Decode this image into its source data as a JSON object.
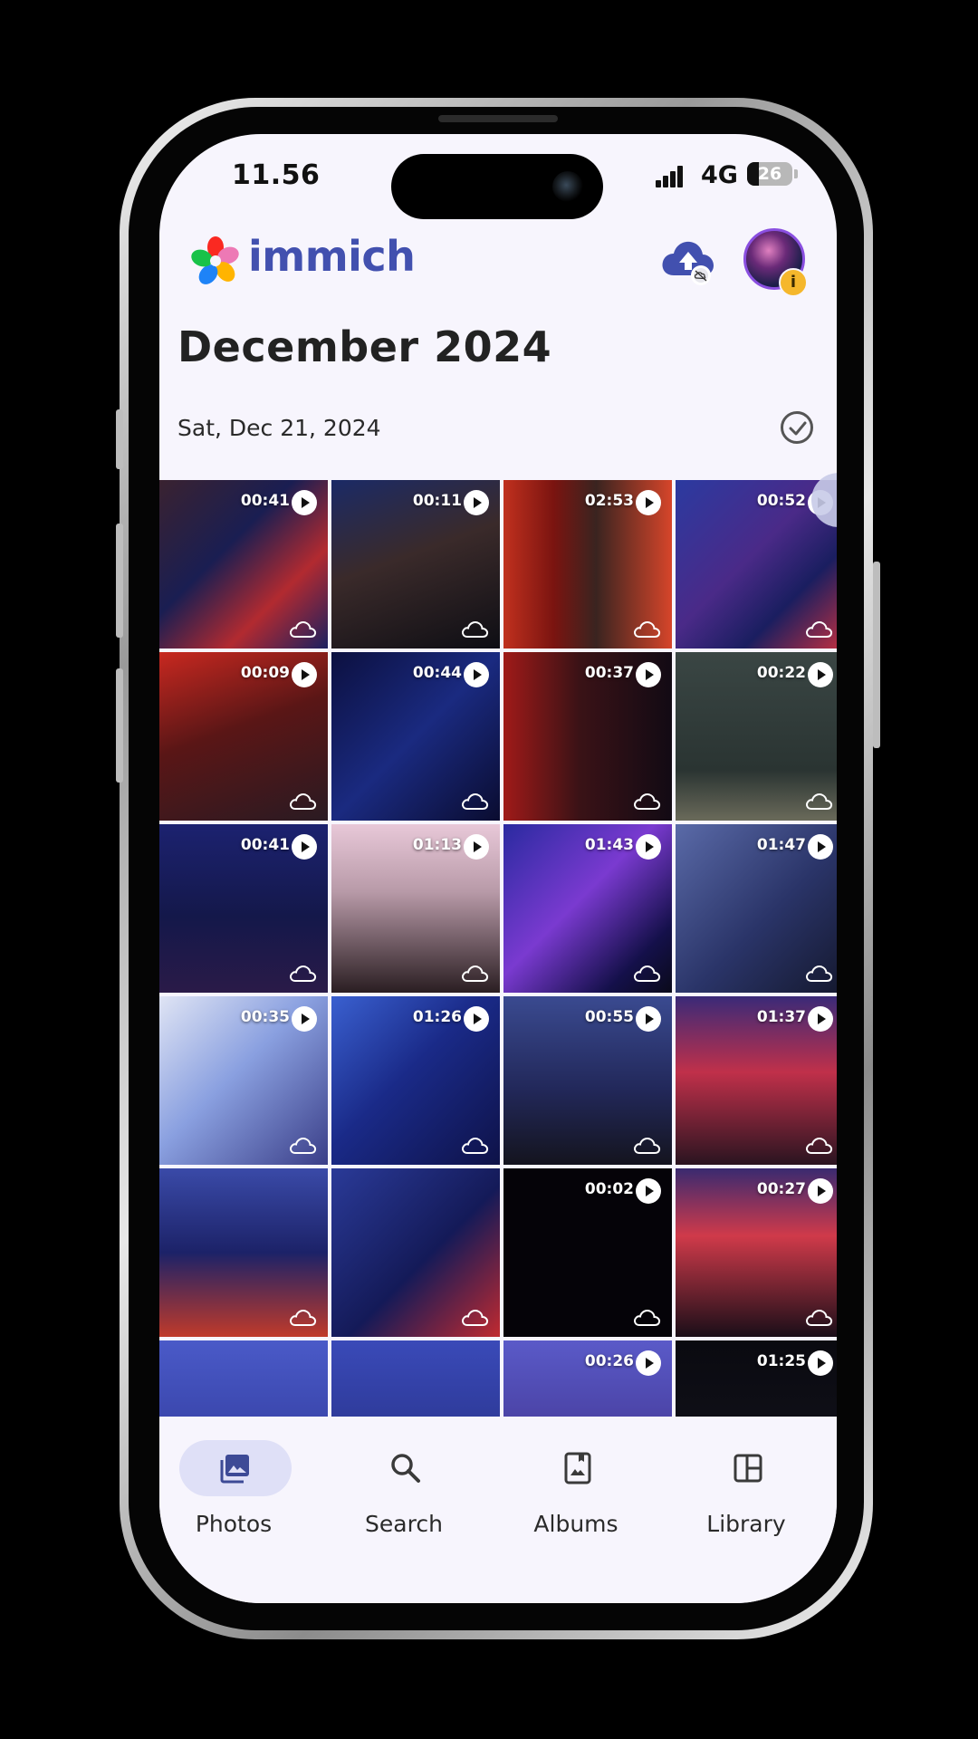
{
  "status_bar": {
    "time": "11.56",
    "network": "4G",
    "battery": "26",
    "battery_level": 0.26
  },
  "header": {
    "app_name": "immich",
    "upload_icon": "cloud-upload-icon",
    "avatar_badge_icon": "info-icon"
  },
  "timeline": {
    "month_title": "December 2024",
    "date_label": "Sat, Dec 21, 2024"
  },
  "tiles": [
    {
      "duration": "00:41",
      "bg": "linear-gradient(135deg,#3a2230 0%,#1a1e52 40%,#b22a30 70%,#1b2060 100%)"
    },
    {
      "duration": "00:11",
      "bg": "linear-gradient(160deg,#1b2a66 0%,#3a2a2a 45%,#0e0e14 100%)"
    },
    {
      "duration": "02:53",
      "bg": "linear-gradient(90deg,#c0301e 0%,#7a1410 30%,#3a2420 55%,#d6452a 100%)"
    },
    {
      "duration": "00:52",
      "bg": "linear-gradient(135deg,#2b3aa0 0%,#4a2a88 45%,#1a1e60 70%,#c03040 100%)"
    },
    {
      "duration": "00:09",
      "bg": "linear-gradient(160deg,#c82820 0%,#5a1616 45%,#2a1a22 100%)"
    },
    {
      "duration": "00:44",
      "bg": "linear-gradient(135deg,#0c1040 0%,#1a2a80 50%,#0a0c30 100%)"
    },
    {
      "duration": "00:37",
      "bg": "linear-gradient(90deg,#a01a18 0%,#3a1216 45%,#120a14 100%)"
    },
    {
      "duration": "00:22",
      "bg": "linear-gradient(180deg,#3a4644 0%,#2a3432 70%,#6a6a5a 100%)"
    },
    {
      "duration": "00:41",
      "bg": "linear-gradient(180deg,#1c2270 0%,#14184a 55%,#2a1a48 100%)"
    },
    {
      "duration": "01:13",
      "bg": "linear-gradient(180deg,#e8c8d8 0%,#b89aa8 40%,#2a1e22 100%)"
    },
    {
      "duration": "01:43",
      "bg": "linear-gradient(135deg,#2a2aa0 0%,#7a3ad0 45%,#14104a 80%,#0a0a1a 100%)"
    },
    {
      "duration": "01:47",
      "bg": "linear-gradient(135deg,#5a6aa8 0%,#2a3468 55%,#14182e 100%)"
    },
    {
      "duration": "00:35",
      "bg": "linear-gradient(135deg,#dfe4f4 0%,#8aa0e0 45%,#3a3e88 100%)"
    },
    {
      "duration": "01:26",
      "bg": "linear-gradient(135deg,#3a60d0 0%,#1a2a88 45%,#0e1248 100%)"
    },
    {
      "duration": "00:55",
      "bg": "linear-gradient(180deg,#3a4a90 0%,#22285a 55%,#14141e 100%)"
    },
    {
      "duration": "01:37",
      "bg": "linear-gradient(180deg,#3a2a78 0%,#c0304a 45%,#2a1420 100%)"
    },
    {
      "duration": "",
      "bg": "linear-gradient(180deg,#3a4aa8 0%,#1c2268 50%,#c03a2a 100%)"
    },
    {
      "duration": "",
      "bg": "linear-gradient(135deg,#2a3a98 0%,#141a58 55%,#c02a30 100%)"
    },
    {
      "duration": "00:02",
      "bg": "#050308"
    },
    {
      "duration": "00:27",
      "bg": "linear-gradient(180deg,#3a2a70 0%,#d03a4a 40%,#1a0e18 100%)"
    },
    {
      "duration": "",
      "bg": "linear-gradient(180deg,#4a5ac8 0%,#2a3290 100%)"
    },
    {
      "duration": "",
      "bg": "linear-gradient(180deg,#3a4ab8 0%,#222a7a 100%)"
    },
    {
      "duration": "00:26",
      "bg": "linear-gradient(180deg,#5a5ac8 0%,#3a2a80 100%)"
    },
    {
      "duration": "01:25",
      "bg": "linear-gradient(180deg,#0a0a10 0%,#14141e 100%)"
    }
  ],
  "nav": {
    "photos": "Photos",
    "search": "Search",
    "albums": "Albums",
    "library": "Library",
    "active": "photos"
  }
}
